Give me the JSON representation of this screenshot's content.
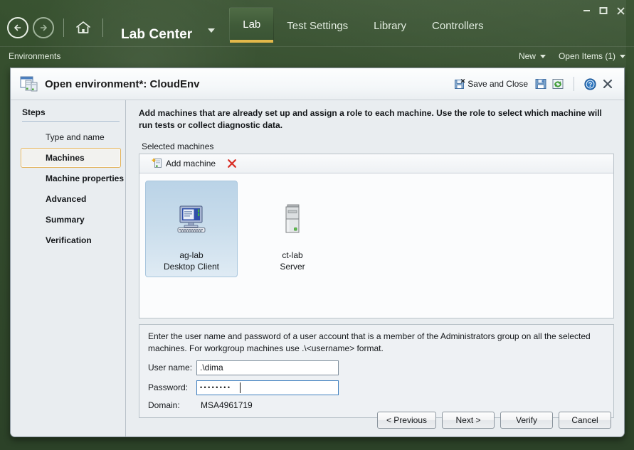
{
  "window": {
    "minimize_label": "—",
    "maximize_label": "□",
    "close_label": "✕"
  },
  "header": {
    "app_title": "Lab Center",
    "back_icon": "back-arrow-icon",
    "forward_icon": "forward-arrow-icon",
    "home_icon": "home-icon",
    "title_dropdown_icon": "chevron-down-icon",
    "tabs": [
      {
        "label": "Lab",
        "active": true
      },
      {
        "label": "Test Settings",
        "active": false
      },
      {
        "label": "Library",
        "active": false
      },
      {
        "label": "Controllers",
        "active": false
      }
    ],
    "accent_underline_color": "#e3b84a",
    "background_color": "#33492c"
  },
  "subbar": {
    "breadcrumb": "Environments",
    "new_label": "New",
    "open_items_label": "Open Items (1)"
  },
  "dialog": {
    "icon": "environment-icon",
    "title": "Open environment*: CloudEnv",
    "actions": {
      "save_and_close": "Save and Close",
      "save_icon": "save-disk-icon",
      "refresh_icon": "refresh-icon",
      "help_icon": "help-question-icon",
      "close_icon": "✕"
    }
  },
  "steps": {
    "title": "Steps",
    "items": [
      {
        "label": "Type and name",
        "state": "done"
      },
      {
        "label": "Machines",
        "state": "current"
      },
      {
        "label": "Machine properties",
        "state": "pending"
      },
      {
        "label": "Advanced",
        "state": "pending"
      },
      {
        "label": "Summary",
        "state": "pending"
      },
      {
        "label": "Verification",
        "state": "pending"
      }
    ]
  },
  "content": {
    "instruction": "Add machines that are already set up and assign a role to each machine. Use the role to select which machine will run tests or collect diagnostic data.",
    "selected_machines_label": "Selected machines",
    "toolbar": {
      "add_machine_label": "Add machine",
      "add_machine_icon": "add-machine-icon",
      "delete_icon": "red-x-delete-icon"
    },
    "machines": [
      {
        "name": "ag-lab",
        "role": "Desktop Client",
        "icon": "desktop-computer-icon",
        "selected": true
      },
      {
        "name": "ct-lab",
        "role": "Server",
        "icon": "server-tower-icon",
        "selected": false
      }
    ]
  },
  "credentials": {
    "description": "Enter the user name and password of a user account that is a member of the Administrators group on all the selected machines. For workgroup machines use .\\<username> format.",
    "user_name_label": "User name:",
    "user_name_value": ".\\dima",
    "password_label": "Password:",
    "password_value": "••••••••",
    "domain_label": "Domain:",
    "domain_value": "MSA4961719"
  },
  "footer": {
    "previous_label": "< Previous",
    "next_label": "Next >",
    "verify_label": "Verify",
    "cancel_label": "Cancel"
  }
}
